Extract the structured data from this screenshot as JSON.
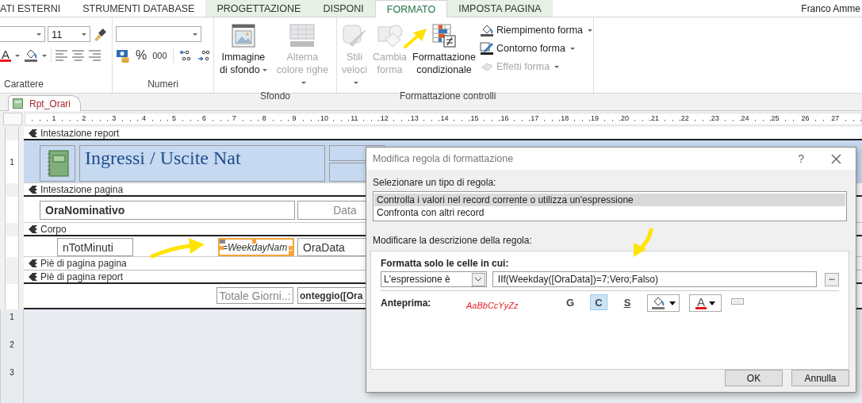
{
  "tabs": [
    {
      "label": "ATI ESTERNI",
      "selected": false,
      "contextual": false
    },
    {
      "label": "STRUMENTI DATABASE",
      "selected": false,
      "contextual": false
    },
    {
      "label": "PROGETTAZIONE",
      "selected": false,
      "contextual": true
    },
    {
      "label": "DISPONI",
      "selected": false,
      "contextual": true
    },
    {
      "label": "FORMATO",
      "selected": true,
      "contextual": true
    },
    {
      "label": "IMPOSTA PAGINA",
      "selected": false,
      "contextual": true
    }
  ],
  "user": "Franco Amme",
  "font_group": {
    "label": "Carattere",
    "font_size": "11",
    "color_letter": "A"
  },
  "number_group": {
    "label": "Numeri",
    "percent": "%",
    "thousands": "000"
  },
  "background_group": {
    "label": "Sfondo",
    "buttons": [
      {
        "label": "Immagine di sfondo",
        "kind": "picture",
        "disabled": false,
        "dropdown": true
      },
      {
        "label": "Alterna colore righe",
        "kind": "rows",
        "disabled": true,
        "dropdown": true
      }
    ]
  },
  "controls_group": {
    "label": "Formattazione controlli",
    "large_buttons": [
      {
        "label": "Stili veloci",
        "kind": "styles",
        "disabled": true,
        "dropdown": true
      },
      {
        "label": "Cambia forma",
        "kind": "shape",
        "disabled": true,
        "dropdown": false
      },
      {
        "label": "Formattazione condizionale",
        "kind": "conditional",
        "disabled": false,
        "dropdown": false
      }
    ],
    "small_buttons": [
      {
        "label": "Riempimento forma",
        "kind": "fill",
        "disabled": false,
        "dropdown": true
      },
      {
        "label": "Contorno forma",
        "kind": "outline",
        "disabled": false,
        "dropdown": true
      },
      {
        "label": "Effetti forma",
        "kind": "effects",
        "disabled": true,
        "dropdown": true
      }
    ]
  },
  "document_tab": {
    "label": "Rpt_Orari"
  },
  "ruler": {
    "marks": [
      "1",
      "2",
      "3",
      "4",
      "5",
      "6",
      "7",
      "8",
      "9",
      "10",
      "11",
      "12",
      "13",
      "14",
      "15",
      "16",
      "17",
      "18",
      "19",
      "20",
      "21",
      "22",
      "23",
      "24",
      "25",
      "26",
      "27"
    ]
  },
  "sections": [
    {
      "title": "Intestazione report",
      "ruler_marks": [
        "1"
      ],
      "controls": [
        {
          "kind": "image",
          "selected": false
        },
        {
          "kind": "title",
          "text": "Ingressi / Uscite Nat",
          "selected": false
        },
        {
          "kind": "box",
          "selected": false
        },
        {
          "kind": "box",
          "selected": false
        }
      ]
    },
    {
      "title": "Intestazione pagina",
      "controls": [
        {
          "kind": "textbox",
          "text": "OraNominativo",
          "bold": true,
          "selected": false
        },
        {
          "kind": "label",
          "text": "Data",
          "selected": false
        }
      ]
    },
    {
      "title": "Corpo",
      "controls": [
        {
          "kind": "textbox",
          "text": "nTotMinuti",
          "selected": false
        },
        {
          "kind": "textbox",
          "text": "=WeekdayNam",
          "italic": true,
          "selected": true
        },
        {
          "kind": "textbox",
          "text": "OraData",
          "selected": false
        }
      ]
    },
    {
      "title": "Piè di pagina pagina"
    },
    {
      "title": "Piè di pagina report",
      "controls": [
        {
          "kind": "label",
          "text": "Totale Giorni..:",
          "selected": false
        },
        {
          "kind": "textbox",
          "text": "onteggio([Ora",
          "bold": true,
          "selected": false
        }
      ]
    }
  ],
  "canvas_ruler_marks": [
    "1",
    "2",
    "3"
  ],
  "dialog": {
    "title": "Modifica regola di formattazione",
    "help": "?",
    "rule_type_label": "Selezionare un tipo di regola:",
    "rule_types": [
      {
        "label": "Controlla i valori nel record corrente o utilizza un'espressione",
        "selected": true
      },
      {
        "label": "Confronta con altri record",
        "selected": false
      }
    ],
    "description_label": "Modificare la descrizione della regola:",
    "condition_label": "Formatta solo le celle in cui:",
    "condition_type": "L'espressione è",
    "expression": "IIf(Weekday([OraData])=7;Vero;Falso)",
    "builder_button": "...",
    "preview_label": "Anteprima:",
    "preview_text": "AaBbCcYyZz",
    "format_toggles": [
      {
        "label": "G",
        "kind": "bold",
        "selected": false
      },
      {
        "label": "C",
        "kind": "italic",
        "selected": true
      },
      {
        "label": "S",
        "kind": "underline",
        "selected": false
      }
    ],
    "font_color_letter": "A",
    "buttons": [
      {
        "label": "OK"
      },
      {
        "label": "Annulla"
      }
    ]
  }
}
